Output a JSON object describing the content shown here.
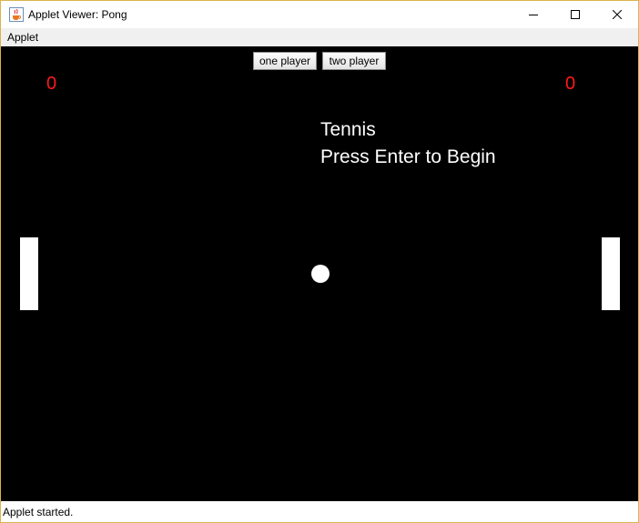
{
  "window": {
    "title": "Applet Viewer: Pong",
    "icon": "java-cup-icon",
    "controls": [
      "minimize-icon",
      "maximize-icon",
      "close-icon"
    ]
  },
  "menubar": {
    "items": [
      {
        "label": "Applet"
      }
    ]
  },
  "game": {
    "buttons": {
      "one_player": "one player",
      "two_player": "two player"
    },
    "score_left": "0",
    "score_right": "0",
    "title": "Tennis",
    "prompt": "Press Enter to Begin",
    "colors": {
      "background": "#000000",
      "score": "#ff1a1a",
      "foreground": "#ffffff"
    }
  },
  "status": {
    "text": "Applet started."
  }
}
